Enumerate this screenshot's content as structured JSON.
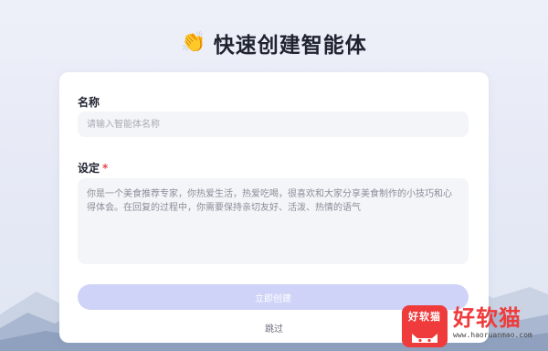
{
  "header": {
    "emoji": "👏",
    "title": "快速创建智能体"
  },
  "form": {
    "name_label": "名称",
    "name_placeholder": "请输入智能体名称",
    "setting_label": "设定",
    "required_mark": "*",
    "setting_text": "你是一个美食推荐专家，你热爱生活，热爱吃喝，很喜欢和大家分享美食制作的小技巧和心得体会。在回复的过程中，你需要保持亲切友好、活泼、热情的语气",
    "create_button": "立即创建",
    "skip_link": "跳过"
  },
  "watermark": {
    "logo_text": "好软猫",
    "brand": "好软猫",
    "url": "www.haoruanmao.com"
  }
}
